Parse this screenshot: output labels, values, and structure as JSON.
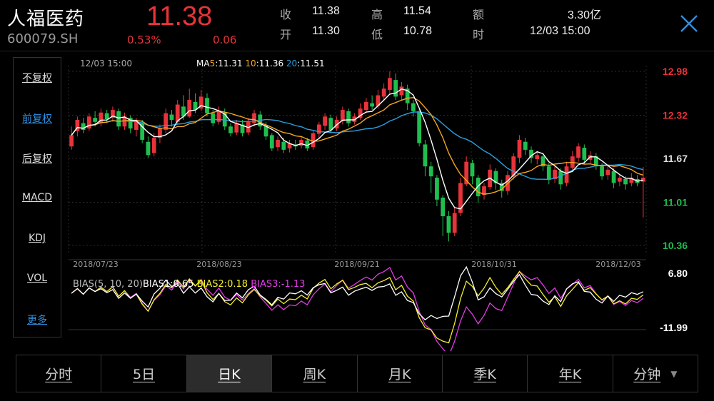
{
  "header": {
    "name": "人福医药",
    "code": "600079.SH",
    "price": "11.38",
    "change_pct": "0.53%",
    "change": "0.06",
    "stats": [
      {
        "label": "收",
        "value": "11.38"
      },
      {
        "label": "高",
        "value": "11.54"
      },
      {
        "label": "额",
        "value": "3.30亿"
      },
      {
        "label": "开",
        "value": "11.30"
      },
      {
        "label": "低",
        "value": "10.78"
      },
      {
        "label": "时",
        "value": "12/03 15:00"
      }
    ]
  },
  "sidebar": {
    "items": [
      {
        "label": "不复权"
      },
      {
        "label": "前复权",
        "active": true
      },
      {
        "label": "后复权"
      },
      {
        "label": "MACD"
      },
      {
        "label": "KDJ"
      },
      {
        "label": "VOL"
      },
      {
        "label": "更多",
        "active": true
      }
    ]
  },
  "chart_info": {
    "time": "12/03 15:00",
    "ma5_label": "MA5:11.31",
    "ma10_label": "10:11.36",
    "ma20_label": "20:11.51",
    "bias_label": "BIAS(5, 10, 20)",
    "bias1_label": "BIAS1:0.65",
    "bias2_label": "BIAS2:0.18",
    "bias3_label": "BIAS3:-1.13"
  },
  "colors": {
    "up": "#e8333a",
    "down": "#1fbf4f",
    "ma5": "#ffffff",
    "ma10": "#f5a623",
    "ma20": "#2a9fe0",
    "bias1": "#ffffff",
    "bias2": "#f3ef2c",
    "bias3": "#e23be6"
  },
  "chart_data": {
    "type": "candlestick",
    "price_axis_ticks": [
      "12.98",
      "12.32",
      "11.67",
      "11.01",
      "10.36"
    ],
    "price_ylim": [
      10.36,
      12.98
    ],
    "date_ticks": [
      "2018/07/23",
      "2018/08/23",
      "2018/09/21",
      "2018/10/31",
      "2018/12/03"
    ],
    "bias_axis_ticks": [
      "6.80",
      "-11.99"
    ],
    "bias_ylim": [
      -11.99,
      6.8
    ],
    "candles": [
      [
        11.85,
        12.02,
        11.8,
        12.15
      ],
      [
        12.08,
        12.25,
        12.0,
        12.3
      ],
      [
        12.2,
        12.1,
        12.05,
        12.28
      ],
      [
        12.12,
        12.3,
        12.08,
        12.35
      ],
      [
        12.28,
        12.22,
        12.15,
        12.38
      ],
      [
        12.2,
        12.36,
        12.15,
        12.42
      ],
      [
        12.35,
        12.26,
        12.2,
        12.4
      ],
      [
        12.28,
        12.4,
        12.22,
        12.45
      ],
      [
        12.38,
        12.15,
        12.1,
        12.42
      ],
      [
        12.15,
        12.3,
        12.1,
        12.36
      ],
      [
        12.28,
        12.12,
        12.05,
        12.32
      ],
      [
        12.1,
        12.22,
        12.0,
        12.28
      ],
      [
        12.2,
        11.95,
        11.9,
        12.25
      ],
      [
        11.92,
        11.72,
        11.68,
        12.0
      ],
      [
        11.75,
        11.98,
        11.7,
        12.05
      ],
      [
        11.98,
        12.12,
        11.9,
        12.18
      ],
      [
        12.1,
        12.35,
        12.05,
        12.42
      ],
      [
        12.33,
        12.25,
        12.15,
        12.4
      ],
      [
        12.22,
        12.48,
        12.18,
        12.55
      ],
      [
        12.45,
        12.3,
        12.25,
        12.62
      ],
      [
        12.3,
        12.55,
        12.28,
        12.72
      ],
      [
        12.52,
        12.4,
        12.35,
        12.65
      ],
      [
        12.42,
        12.6,
        12.38,
        12.7
      ],
      [
        12.58,
        12.35,
        12.3,
        12.65
      ],
      [
        12.35,
        12.2,
        12.15,
        12.4
      ],
      [
        12.22,
        12.38,
        12.18,
        12.45
      ],
      [
        12.36,
        12.15,
        12.1,
        12.42
      ],
      [
        12.15,
        12.05,
        12.0,
        12.2
      ],
      [
        12.06,
        12.2,
        12.02,
        12.25
      ],
      [
        12.18,
        12.05,
        12.0,
        12.25
      ],
      [
        12.06,
        12.22,
        12.02,
        12.28
      ],
      [
        12.2,
        12.35,
        12.15,
        12.4
      ],
      [
        12.33,
        12.15,
        12.1,
        12.38
      ],
      [
        12.16,
        12.0,
        11.95,
        12.22
      ],
      [
        12.02,
        11.82,
        11.78,
        12.05
      ],
      [
        11.84,
        11.95,
        11.78,
        12.0
      ],
      [
        11.92,
        11.8,
        11.75,
        11.98
      ],
      [
        11.82,
        11.9,
        11.76,
        11.95
      ],
      [
        11.88,
        11.85,
        11.8,
        11.95
      ],
      [
        11.86,
        11.95,
        11.82,
        12.0
      ],
      [
        11.94,
        11.82,
        11.78,
        11.98
      ],
      [
        11.84,
        12.05,
        11.8,
        12.1
      ],
      [
        12.04,
        12.18,
        11.98,
        12.22
      ],
      [
        12.16,
        12.3,
        12.1,
        12.35
      ],
      [
        12.28,
        12.1,
        12.05,
        12.33
      ],
      [
        12.12,
        12.25,
        12.08,
        12.3
      ],
      [
        12.23,
        12.4,
        12.18,
        12.45
      ],
      [
        12.38,
        12.2,
        12.15,
        12.42
      ],
      [
        12.22,
        12.3,
        12.18,
        12.35
      ],
      [
        12.28,
        12.42,
        12.25,
        12.5
      ],
      [
        12.4,
        12.52,
        12.35,
        12.58
      ],
      [
        12.5,
        12.45,
        12.4,
        12.62
      ],
      [
        12.46,
        12.62,
        12.42,
        12.7
      ],
      [
        12.6,
        12.72,
        12.55,
        12.8
      ],
      [
        12.7,
        12.88,
        12.65,
        12.98
      ],
      [
        12.85,
        12.6,
        12.55,
        12.95
      ],
      [
        12.62,
        12.75,
        12.55,
        12.82
      ],
      [
        12.72,
        12.5,
        12.4,
        12.78
      ],
      [
        12.5,
        12.38,
        12.3,
        12.55
      ],
      [
        12.38,
        11.9,
        11.85,
        12.42
      ],
      [
        11.88,
        11.55,
        11.4,
        11.95
      ],
      [
        11.55,
        11.4,
        11.15,
        11.62
      ],
      [
        11.38,
        11.05,
        10.95,
        11.42
      ],
      [
        11.08,
        10.8,
        10.5,
        11.12
      ],
      [
        10.8,
        10.55,
        10.42,
        10.88
      ],
      [
        10.55,
        10.85,
        10.5,
        10.92
      ],
      [
        10.85,
        11.3,
        10.8,
        11.38
      ],
      [
        11.28,
        11.62,
        11.25,
        11.7
      ],
      [
        11.6,
        11.4,
        11.28,
        11.65
      ],
      [
        11.38,
        11.1,
        11.0,
        11.42
      ],
      [
        11.12,
        11.25,
        11.05,
        11.3
      ],
      [
        11.24,
        11.5,
        11.2,
        11.58
      ],
      [
        11.48,
        11.3,
        11.2,
        11.52
      ],
      [
        11.3,
        11.18,
        11.08,
        11.35
      ],
      [
        11.18,
        11.42,
        11.12,
        11.48
      ],
      [
        11.4,
        11.7,
        11.35,
        11.75
      ],
      [
        11.68,
        11.95,
        11.6,
        12.02
      ],
      [
        11.92,
        11.8,
        11.72,
        11.98
      ],
      [
        11.8,
        11.68,
        11.6,
        11.85
      ],
      [
        11.66,
        11.72,
        11.58,
        11.78
      ],
      [
        11.7,
        11.55,
        11.48,
        11.75
      ],
      [
        11.55,
        11.35,
        11.28,
        11.6
      ],
      [
        11.36,
        11.5,
        11.3,
        11.55
      ],
      [
        11.48,
        11.28,
        11.2,
        11.52
      ],
      [
        11.3,
        11.55,
        11.25,
        11.62
      ],
      [
        11.53,
        11.7,
        11.48,
        11.78
      ],
      [
        11.68,
        11.85,
        11.62,
        11.9
      ],
      [
        11.83,
        11.65,
        11.58,
        11.88
      ],
      [
        11.65,
        11.72,
        11.6,
        11.78
      ],
      [
        11.7,
        11.55,
        11.5,
        11.75
      ],
      [
        11.55,
        11.4,
        11.35,
        11.6
      ],
      [
        11.42,
        11.5,
        11.35,
        11.55
      ],
      [
        11.48,
        11.3,
        11.22,
        11.52
      ],
      [
        11.32,
        11.38,
        11.25,
        11.42
      ],
      [
        11.36,
        11.28,
        11.2,
        11.4
      ],
      [
        11.3,
        11.38,
        11.25,
        11.45
      ],
      [
        11.36,
        11.3,
        11.25,
        11.42
      ],
      [
        11.32,
        11.38,
        10.78,
        11.54
      ]
    ]
  }
}
